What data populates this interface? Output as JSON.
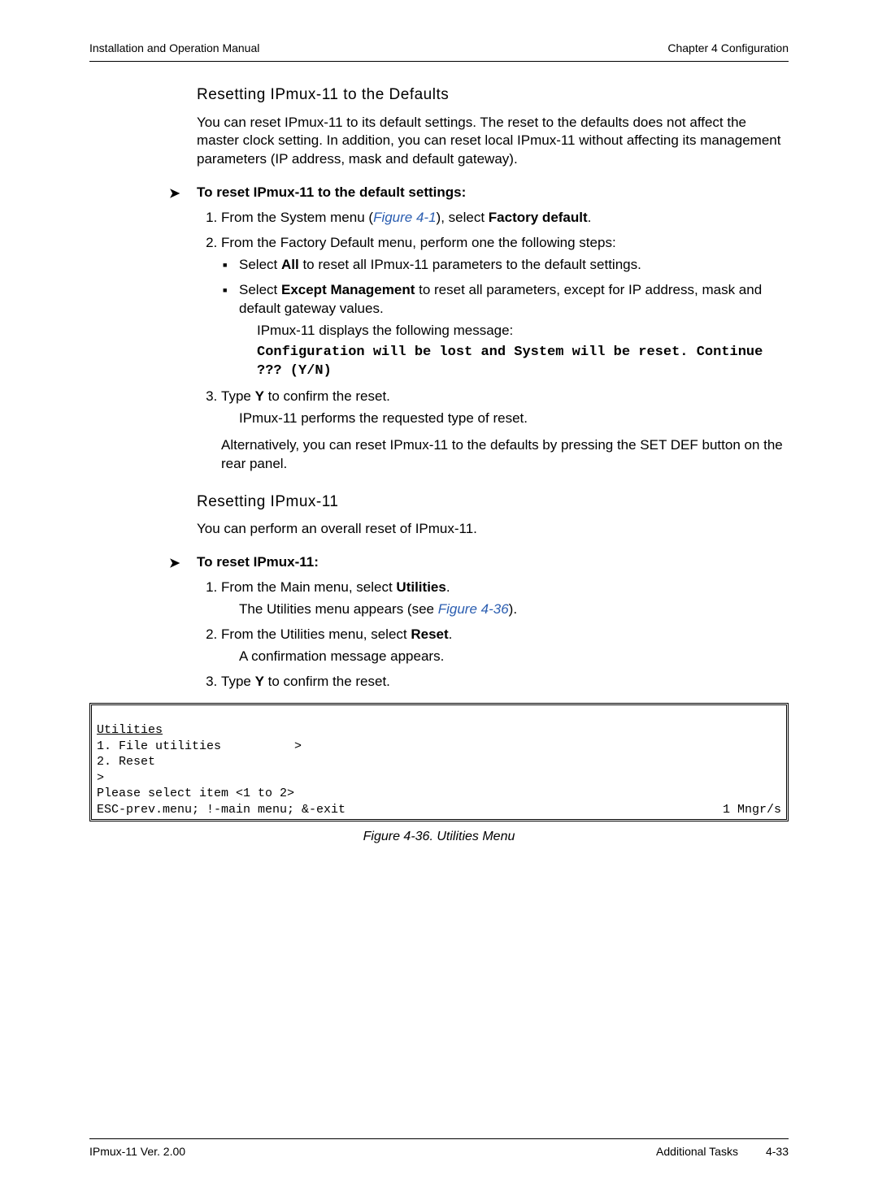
{
  "header": {
    "left": "Installation and Operation Manual",
    "right": "Chapter 4  Configuration"
  },
  "sec1": {
    "title": "Resetting IPmux-11 to the Defaults",
    "intro": "You can reset IPmux-11 to its default settings. The reset to the defaults does not affect the master clock setting. In addition, you can reset local IPmux-11 without affecting its management parameters (IP address, mask and default gateway)."
  },
  "proc1": {
    "head": "To reset IPmux-11 to the default settings:",
    "step1_pre": "From the System menu (",
    "step1_ref": "Figure 4-1",
    "step1_mid": "), select ",
    "step1_bold": "Factory default",
    "step1_post": ".",
    "step2": "From the Factory Default menu, perform one the following steps:",
    "step2a_pre": "Select ",
    "step2a_bold": "All",
    "step2a_post": " to reset all IPmux-11 parameters to the default settings.",
    "step2b_pre": "Select ",
    "step2b_bold": "Except Management",
    "step2b_post": " to reset all parameters, except for IP address, mask and default gateway values.",
    "msg_lead": "IPmux-11 displays the following message:",
    "msg_code": "Configuration will be lost and System will be reset. Continue ??? (Y/N)",
    "step3_pre": "Type ",
    "step3_bold": "Y",
    "step3_post": " to confirm the reset.",
    "step3_result": "IPmux-11 performs the requested type of reset.",
    "alt": "Alternatively, you can reset IPmux-11 to the defaults by pressing the SET DEF button on the rear panel."
  },
  "sec2": {
    "title": "Resetting IPmux-11",
    "intro": "You can perform an overall reset of IPmux-11."
  },
  "proc2": {
    "head": "To reset IPmux-11:",
    "step1_pre": "From the Main menu, select ",
    "step1_bold": "Utilities",
    "step1_post": ".",
    "step1_res_pre": "The Utilities menu appears (see ",
    "step1_res_ref": "Figure 4-36",
    "step1_res_post": ").",
    "step2_pre": "From the Utilities menu, select ",
    "step2_bold": "Reset",
    "step2_post": ".",
    "step2_res": "A confirmation message appears.",
    "step3_pre": "Type ",
    "step3_bold": "Y",
    "step3_post": " to confirm the reset."
  },
  "terminal": {
    "title": "Utilities",
    "l1": "1. File utilities          >",
    "l2": "2. Reset",
    "l3": ">",
    "l4": "Please select item <1 to 2>",
    "l5_left": "ESC-prev.menu; !-main menu; &-exit",
    "l5_right": "1 Mngr/s"
  },
  "figure_caption": "Figure 4-36.  Utilities Menu",
  "footer": {
    "left": "IPmux-11 Ver. 2.00",
    "right1": "Additional Tasks",
    "right2": "4-33"
  }
}
